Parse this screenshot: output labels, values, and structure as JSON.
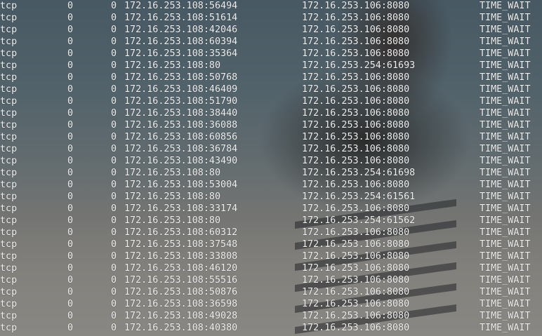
{
  "rows": [
    {
      "proto": "tcp",
      "recv_q": "0",
      "send_q": "0",
      "local": "172.16.253.108:56494",
      "foreign": "172.16.253.106:8080",
      "state": "TIME_WAIT"
    },
    {
      "proto": "tcp",
      "recv_q": "0",
      "send_q": "0",
      "local": "172.16.253.108:51614",
      "foreign": "172.16.253.106:8080",
      "state": "TIME_WAIT"
    },
    {
      "proto": "tcp",
      "recv_q": "0",
      "send_q": "0",
      "local": "172.16.253.108:42046",
      "foreign": "172.16.253.106:8080",
      "state": "TIME_WAIT"
    },
    {
      "proto": "tcp",
      "recv_q": "0",
      "send_q": "0",
      "local": "172.16.253.108:60394",
      "foreign": "172.16.253.106:8080",
      "state": "TIME_WAIT"
    },
    {
      "proto": "tcp",
      "recv_q": "0",
      "send_q": "0",
      "local": "172.16.253.108:35364",
      "foreign": "172.16.253.106:8080",
      "state": "TIME_WAIT"
    },
    {
      "proto": "tcp",
      "recv_q": "0",
      "send_q": "0",
      "local": "172.16.253.108:80",
      "foreign": "172.16.253.254:61693",
      "state": "TIME_WAIT"
    },
    {
      "proto": "tcp",
      "recv_q": "0",
      "send_q": "0",
      "local": "172.16.253.108:50768",
      "foreign": "172.16.253.106:8080",
      "state": "TIME_WAIT"
    },
    {
      "proto": "tcp",
      "recv_q": "0",
      "send_q": "0",
      "local": "172.16.253.108:46409",
      "foreign": "172.16.253.106:8080",
      "state": "TIME_WAIT"
    },
    {
      "proto": "tcp",
      "recv_q": "0",
      "send_q": "0",
      "local": "172.16.253.108:51790",
      "foreign": "172.16.253.106:8080",
      "state": "TIME_WAIT"
    },
    {
      "proto": "tcp",
      "recv_q": "0",
      "send_q": "0",
      "local": "172.16.253.108:38440",
      "foreign": "172.16.253.106:8080",
      "state": "TIME_WAIT"
    },
    {
      "proto": "tcp",
      "recv_q": "0",
      "send_q": "0",
      "local": "172.16.253.108:36088",
      "foreign": "172.16.253.106:8080",
      "state": "TIME_WAIT"
    },
    {
      "proto": "tcp",
      "recv_q": "0",
      "send_q": "0",
      "local": "172.16.253.108:60856",
      "foreign": "172.16.253.106:8080",
      "state": "TIME_WAIT"
    },
    {
      "proto": "tcp",
      "recv_q": "0",
      "send_q": "0",
      "local": "172.16.253.108:36784",
      "foreign": "172.16.253.106:8080",
      "state": "TIME_WAIT"
    },
    {
      "proto": "tcp",
      "recv_q": "0",
      "send_q": "0",
      "local": "172.16.253.108:43490",
      "foreign": "172.16.253.106:8080",
      "state": "TIME_WAIT"
    },
    {
      "proto": "tcp",
      "recv_q": "0",
      "send_q": "0",
      "local": "172.16.253.108:80",
      "foreign": "172.16.253.254:61698",
      "state": "TIME_WAIT"
    },
    {
      "proto": "tcp",
      "recv_q": "0",
      "send_q": "0",
      "local": "172.16.253.108:53004",
      "foreign": "172.16.253.106:8080",
      "state": "TIME_WAIT"
    },
    {
      "proto": "tcp",
      "recv_q": "0",
      "send_q": "0",
      "local": "172.16.253.108:80",
      "foreign": "172.16.253.254:61561",
      "state": "TIME_WAIT"
    },
    {
      "proto": "tcp",
      "recv_q": "0",
      "send_q": "0",
      "local": "172.16.253.108:33174",
      "foreign": "172.16.253.106:8080",
      "state": "TIME_WAIT"
    },
    {
      "proto": "tcp",
      "recv_q": "0",
      "send_q": "0",
      "local": "172.16.253.108:80",
      "foreign": "172.16.253.254:61562",
      "state": "TIME_WAIT"
    },
    {
      "proto": "tcp",
      "recv_q": "0",
      "send_q": "0",
      "local": "172.16.253.108:60312",
      "foreign": "172.16.253.106:8080",
      "state": "TIME_WAIT"
    },
    {
      "proto": "tcp",
      "recv_q": "0",
      "send_q": "0",
      "local": "172.16.253.108:37548",
      "foreign": "172.16.253.106:8080",
      "state": "TIME_WAIT"
    },
    {
      "proto": "tcp",
      "recv_q": "0",
      "send_q": "0",
      "local": "172.16.253.108:33808",
      "foreign": "172.16.253.106:8080",
      "state": "TIME_WAIT"
    },
    {
      "proto": "tcp",
      "recv_q": "0",
      "send_q": "0",
      "local": "172.16.253.108:46120",
      "foreign": "172.16.253.106:8080",
      "state": "TIME_WAIT"
    },
    {
      "proto": "tcp",
      "recv_q": "0",
      "send_q": "0",
      "local": "172.16.253.108:55516",
      "foreign": "172.16.253.106:8080",
      "state": "TIME_WAIT"
    },
    {
      "proto": "tcp",
      "recv_q": "0",
      "send_q": "0",
      "local": "172.16.253.108:50876",
      "foreign": "172.16.253.106:8080",
      "state": "TIME_WAIT"
    },
    {
      "proto": "tcp",
      "recv_q": "0",
      "send_q": "0",
      "local": "172.16.253.108:36598",
      "foreign": "172.16.253.106:8080",
      "state": "TIME_WAIT"
    },
    {
      "proto": "tcp",
      "recv_q": "0",
      "send_q": "0",
      "local": "172.16.253.108:49028",
      "foreign": "172.16.253.106:8080",
      "state": "TIME_WAIT"
    },
    {
      "proto": "tcp",
      "recv_q": "0",
      "send_q": "0",
      "local": "172.16.253.108:40380",
      "foreign": "172.16.253.106:8080",
      "state": "TIME_WAIT"
    }
  ],
  "colors": {
    "text": "#f1f1f1",
    "terminal_tint": "#2d3034"
  }
}
